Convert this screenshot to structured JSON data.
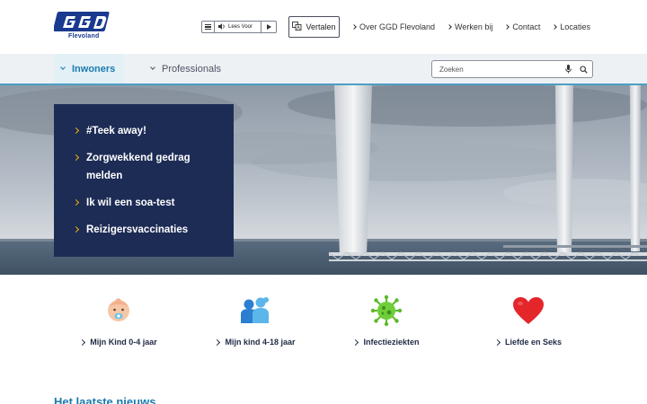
{
  "brand": {
    "logo_text": "GGD",
    "region": "Flevoland",
    "colors": {
      "navy": "#1d2c55",
      "blue": "#1a3a8f",
      "accent": "#1b7bb0",
      "yellow": "#f4b400"
    }
  },
  "header": {
    "readspeaker": {
      "label": "Lees Voor",
      "menu_icon": "menu-icon",
      "speaker_icon": "speaker-icon",
      "play_icon": "play-icon"
    },
    "translate": {
      "label": "Vertalen",
      "icon": "translate-icon"
    },
    "links": [
      {
        "label": "Over GGD Flevoland"
      },
      {
        "label": "Werken bij"
      },
      {
        "label": "Contact"
      },
      {
        "label": "Locaties"
      }
    ]
  },
  "nav": {
    "tabs": [
      {
        "label": "Inwoners",
        "active": true
      },
      {
        "label": "Professionals",
        "active": false
      }
    ],
    "search": {
      "placeholder": "Zoeken",
      "value": "",
      "mic_icon": "microphone-icon",
      "search_icon": "search-icon"
    }
  },
  "hero": {
    "links": [
      {
        "label": "#Teek away!"
      },
      {
        "label": "Zorgwekkend gedrag melden"
      },
      {
        "label": "Ik wil een soa-test"
      },
      {
        "label": "Reizigersvaccinaties"
      }
    ]
  },
  "categories": [
    {
      "label": "Mijn Kind 0-4 jaar",
      "icon": "baby-icon"
    },
    {
      "label": "Mijn kind 4-18 jaar",
      "icon": "children-icon"
    },
    {
      "label": "Infectieziekten",
      "icon": "virus-icon"
    },
    {
      "label": "Liefde en Seks",
      "icon": "heart-icon"
    }
  ],
  "news": {
    "title": "Het laatste nieuws"
  }
}
